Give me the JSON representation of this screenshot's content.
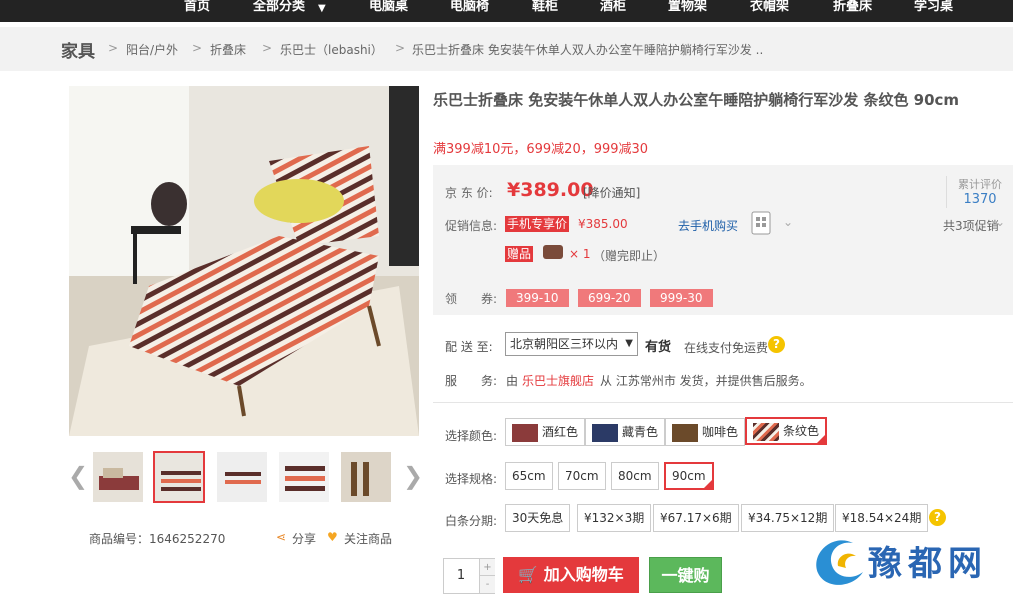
{
  "nav": [
    "首页",
    "全部分类",
    "电脑桌",
    "电脑椅",
    "鞋柜",
    "酒柜",
    "置物架",
    "衣帽架",
    "折叠床",
    "学习桌"
  ],
  "nav_dropdown_icon": "caret-down-icon",
  "breadcrumb": {
    "root": "家具",
    "items": [
      "阳台/户外",
      "折叠床",
      "乐巴士（lebashi）",
      "乐巴士折叠床 免安装午休单人双人办公室午睡陪护躺椅行军沙发 .."
    ]
  },
  "product": {
    "title": "乐巴士折叠床 免安装午休单人双人办公室午睡陪护躺椅行军沙发 条纹色 90cm",
    "promo": "满399减10元，699减20，999减30",
    "price_label": "京 东 价:",
    "price": "¥389.00",
    "price_notice": "[降价通知]",
    "rating_label": "累计评价",
    "rating_count": "1370",
    "promo_label": "促销信息:",
    "mobile_tag": "手机专享价",
    "mobile_price": "¥385.00",
    "mobile_link": "去手机购买",
    "promo_total": "共3项促销",
    "gift_tag": "赠品",
    "gift_qty": "× 1",
    "gift_note": "（赠完即止）",
    "coupon_label": "领　　券:",
    "coupons": [
      "399-10",
      "699-20",
      "999-30"
    ],
    "sku": "商品编号：1646252270",
    "share": "分享",
    "follow": "关注商品"
  },
  "delivery": {
    "label": "配 送 至:",
    "region": "北京朝阳区三环以内",
    "stock": "有货",
    "shipping": "在线支付免运费",
    "service_label": "服　　务:",
    "service_pre": "由",
    "store": "乐巴士旗舰店",
    "service_post": "从 江苏常州市 发货，并提供售后服务。"
  },
  "options": {
    "color_label": "选择颜色:",
    "colors": [
      "酒红色",
      "藏青色",
      "咖啡色",
      "条纹色"
    ],
    "size_label": "选择规格:",
    "sizes": [
      "65cm",
      "70cm",
      "80cm",
      "90cm"
    ],
    "installment_label": "白条分期:",
    "installments": [
      "30天免息",
      "¥132×3期",
      "¥67.17×6期",
      "¥34.75×12期",
      "¥18.54×24期"
    ]
  },
  "purchase": {
    "quantity": "1",
    "add_to_cart": "加入购物车",
    "buy_now": "一键购"
  },
  "watermark": "豫都网",
  "colors": {
    "accent": "#e4393c",
    "link": "#1e5fa8",
    "buy": "#5cb85c"
  }
}
